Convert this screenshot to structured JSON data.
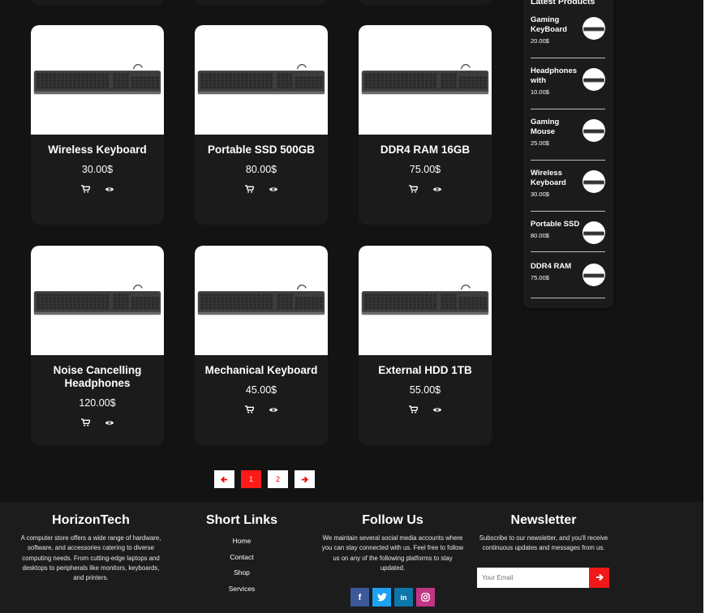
{
  "products": [
    {
      "name": "Wireless Keyboard",
      "price": "30.00$"
    },
    {
      "name": "Portable SSD 500GB",
      "price": "80.00$"
    },
    {
      "name": "DDR4 RAM 16GB",
      "price": "75.00$"
    },
    {
      "name": "Noise Cancelling Headphones",
      "price": "120.00$"
    },
    {
      "name": "Mechanical Keyboard",
      "price": "45.00$"
    },
    {
      "name": "External HDD 1TB",
      "price": "55.00$"
    }
  ],
  "sidebar": {
    "title": "Latest Products",
    "items": [
      {
        "name": "Gaming KeyBoard",
        "price": "20.00$"
      },
      {
        "name": "Headphones with",
        "price": "10.00$"
      },
      {
        "name": "Gaming Mouse",
        "price": "25.00$"
      },
      {
        "name": "Wireless Keyboard",
        "price": "30.00$"
      },
      {
        "name": "Portable SSD",
        "price": "80.00$"
      },
      {
        "name": "DDR4 RAM",
        "price": "75.00$"
      }
    ]
  },
  "pagination": {
    "pages": [
      "1",
      "2"
    ],
    "current": "1"
  },
  "footer": {
    "brand": {
      "title": "HorizonTech",
      "text": "A computer store offers a wide range of hardware, software, and accessories catering to diverse computing needs. From cutting-edge laptops and desktops to peripherals like monitors, keyboards, and printers."
    },
    "links": {
      "title": "Short Links",
      "items": [
        "Home",
        "Contact",
        "Shop",
        "Services"
      ]
    },
    "follow": {
      "title": "Follow Us",
      "text": "We maintain several social media accounts where you can stay connected with us. Feel free to follow us on any of the following platforms to stay updated.",
      "icons": [
        "facebook-icon",
        "twitter-icon",
        "linkedin-icon",
        "instagram-icon"
      ]
    },
    "newsletter": {
      "title": "Newsletter",
      "text": "Subscribe to our newsletter, and you'll receive continuous updates and messages from us.",
      "placeholder": "Your Email"
    }
  },
  "colors": {
    "background": "#131313",
    "card": "#1b1b1b",
    "accent": "#ff1a1a",
    "facebook": "#3b5998",
    "twitter": "#1da1f2",
    "linkedin": "#0e76a8",
    "instagram": "#c13584"
  }
}
